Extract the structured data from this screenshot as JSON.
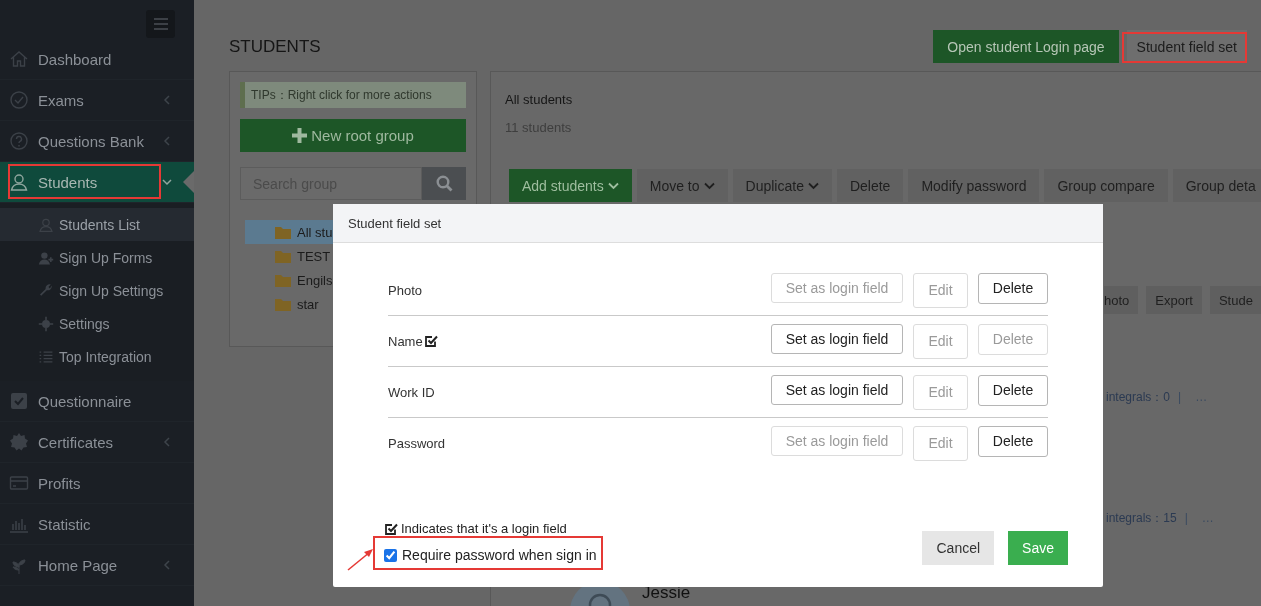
{
  "sidebar": {
    "items": [
      {
        "label": "Dashboard",
        "selected": false
      },
      {
        "label": "Exams",
        "selected": false,
        "expanded": false
      },
      {
        "label": "Questions Bank",
        "selected": false,
        "expanded": false
      },
      {
        "label": "Students",
        "selected": true,
        "expanded": true,
        "children": [
          {
            "label": "Students List",
            "selected": true
          },
          {
            "label": "Sign Up Forms",
            "selected": false
          },
          {
            "label": "Sign Up Settings",
            "selected": false
          },
          {
            "label": "Settings",
            "selected": false
          },
          {
            "label": "Top Integration",
            "selected": false
          }
        ]
      },
      {
        "label": "Questionnaire",
        "selected": false
      },
      {
        "label": "Certificates",
        "selected": false,
        "expanded": false
      },
      {
        "label": "Profits",
        "selected": false
      },
      {
        "label": "Statistic",
        "selected": false
      },
      {
        "label": "Home Page",
        "selected": false,
        "expanded": false
      }
    ]
  },
  "page_title": "STUDENTS",
  "header_buttons": [
    {
      "label": "Open student Login page",
      "kind": "primary"
    },
    {
      "label": "Student field set",
      "kind": "plain"
    }
  ],
  "groups_panel": {
    "tip": "TIPs：Right click for more actions",
    "new_group_button": "New root group",
    "search": {
      "placeholder": "Search group"
    },
    "tree": [
      {
        "label": "All stu",
        "selected": true
      },
      {
        "label": "TEST",
        "selected": false
      },
      {
        "label": "Engils",
        "selected": false
      },
      {
        "label": "star",
        "selected": false
      }
    ]
  },
  "students_panel": {
    "title": "All students",
    "count": "11 students",
    "toolbar": [
      {
        "label": "Add students",
        "kind": "primary",
        "dropdown": true
      },
      {
        "label": "Move to",
        "kind": "plain",
        "dropdown": true
      },
      {
        "label": "Duplicate",
        "kind": "plain",
        "dropdown": true
      },
      {
        "label": "Delete",
        "kind": "plain",
        "dropdown": false
      },
      {
        "label": "Modify password",
        "kind": "plain",
        "dropdown": false
      },
      {
        "label": "Group compare",
        "kind": "plain",
        "dropdown": false
      },
      {
        "label": "Group deta",
        "kind": "plain"
      }
    ],
    "secondary_toolbar": [
      "hoto",
      "Export",
      "Stude"
    ],
    "rows": [
      {
        "integrals": "integrals：0",
        "separator": "|",
        "more": "…"
      },
      {
        "integrals": "integrals：15",
        "separator": "|",
        "more": "…"
      }
    ],
    "last_student": "Jessie"
  },
  "modal": {
    "title": "Student field set",
    "fields": [
      {
        "name": "Photo",
        "login": false,
        "actions": [
          {
            "label": "Set as login field",
            "disabled": true
          },
          {
            "label": "Edit",
            "disabled": true
          },
          {
            "label": "Delete",
            "disabled": false
          }
        ]
      },
      {
        "name": "Name",
        "login": true,
        "actions": [
          {
            "label": "Set as login field",
            "disabled": false
          },
          {
            "label": "Edit",
            "disabled": true
          },
          {
            "label": "Delete",
            "disabled": true
          }
        ]
      },
      {
        "name": "Work ID",
        "login": false,
        "actions": [
          {
            "label": "Set as login field",
            "disabled": false
          },
          {
            "label": "Edit",
            "disabled": true
          },
          {
            "label": "Delete",
            "disabled": false
          }
        ]
      },
      {
        "name": "Password",
        "login": false,
        "actions": [
          {
            "label": "Set as login field",
            "disabled": true
          },
          {
            "label": "Edit",
            "disabled": true
          },
          {
            "label": "Delete",
            "disabled": false
          }
        ]
      }
    ],
    "legend": "Indicates that it's a login field",
    "require_password": {
      "label": "Require password when sign in",
      "checked": true
    },
    "buttons": [
      {
        "label": "Cancel",
        "kind": "default"
      },
      {
        "label": "Save",
        "kind": "primary"
      }
    ]
  }
}
